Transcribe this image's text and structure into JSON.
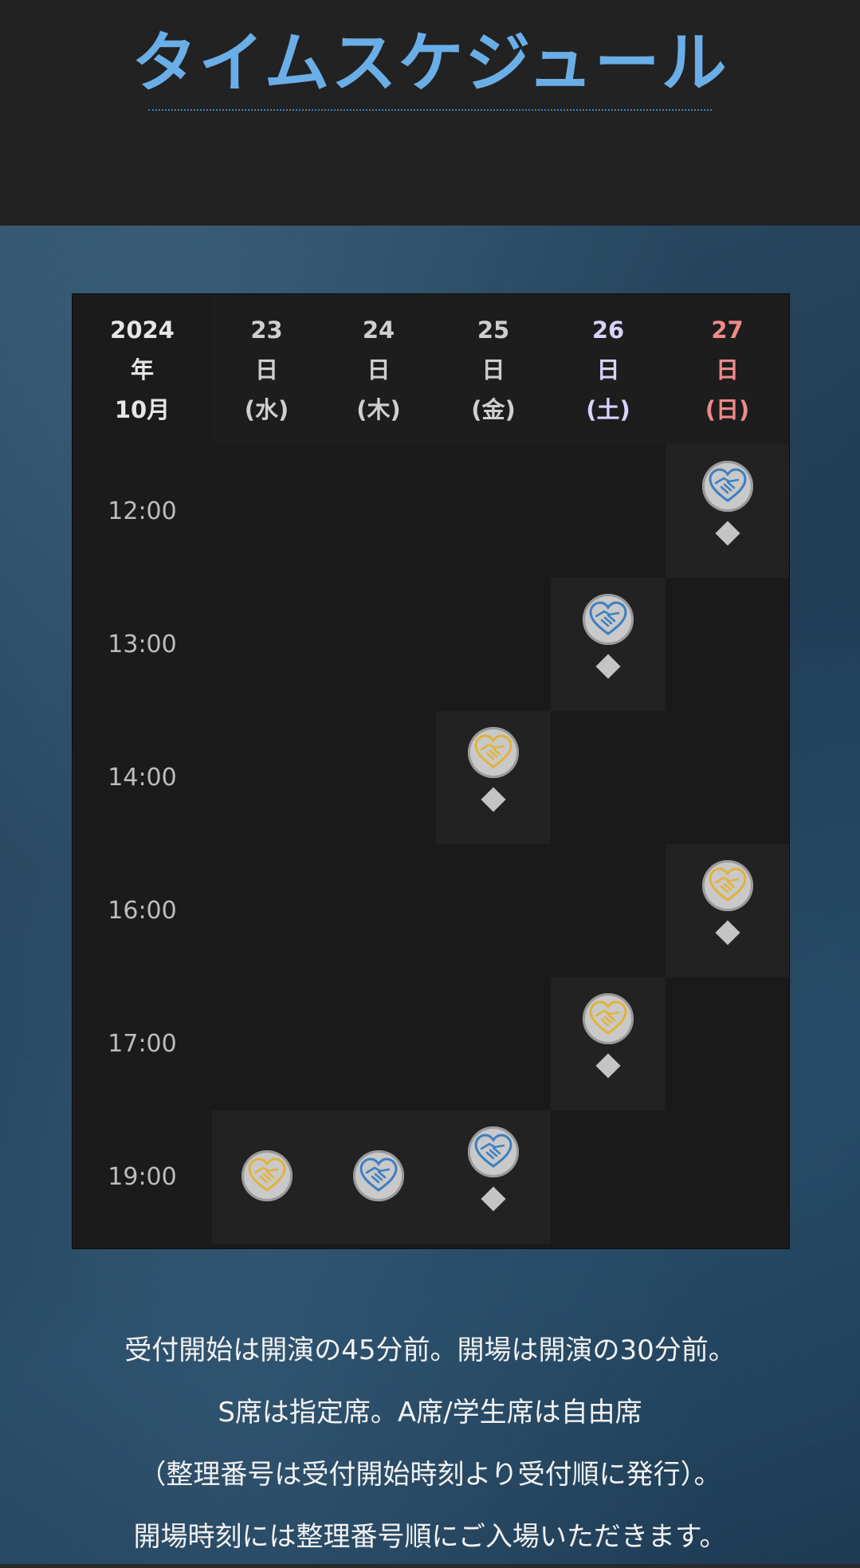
{
  "page": {
    "title": "タイムスケジュール",
    "title_color": "#6aaee8"
  },
  "table": {
    "corner": [
      "2024",
      "年",
      "10月"
    ],
    "days": [
      {
        "lines": [
          "23",
          "日",
          "(水)"
        ],
        "color": "#cfcfcf"
      },
      {
        "lines": [
          "24",
          "日",
          "(木)"
        ],
        "color": "#cfcfcf"
      },
      {
        "lines": [
          "25",
          "日",
          "(金)"
        ],
        "color": "#cfcfcf"
      },
      {
        "lines": [
          "26",
          "日",
          "(土)"
        ],
        "color": "#d9d2ff"
      },
      {
        "lines": [
          "27",
          "日",
          "(日)"
        ],
        "color": "#f08a8a"
      }
    ],
    "times": [
      "12:00",
      "13:00",
      "14:00",
      "16:00",
      "17:00",
      "19:00"
    ],
    "slots": [
      {
        "time": "12:00",
        "day": "27",
        "icon": "handshake-heart-icon",
        "icon_color": "blue",
        "diamond": true
      },
      {
        "time": "13:00",
        "day": "26",
        "icon": "handshake-heart-icon",
        "icon_color": "blue",
        "diamond": true
      },
      {
        "time": "14:00",
        "day": "25",
        "icon": "handshake-heart-icon",
        "icon_color": "gold",
        "diamond": true
      },
      {
        "time": "16:00",
        "day": "27",
        "icon": "handshake-heart-icon",
        "icon_color": "gold",
        "diamond": true
      },
      {
        "time": "17:00",
        "day": "26",
        "icon": "handshake-heart-icon",
        "icon_color": "gold",
        "diamond": true
      },
      {
        "time": "19:00",
        "day": "23",
        "icon": "handshake-heart-icon",
        "icon_color": "gold",
        "diamond": false
      },
      {
        "time": "19:00",
        "day": "24",
        "icon": "handshake-heart-icon",
        "icon_color": "blue",
        "diamond": false
      },
      {
        "time": "19:00",
        "day": "25",
        "icon": "handshake-heart-icon",
        "icon_color": "blue",
        "diamond": true
      }
    ],
    "icon_colors": {
      "blue": "#3d7fc1",
      "gold": "#e2b23a"
    }
  },
  "notes": [
    "受付開始は開演の45分前。開場は開演の30分前。",
    "S席は指定席。A席/学生席は自由席",
    "（整理番号は受付開始時刻より受付順に発行）。",
    "開場時刻には整理番号順にご入場いただきます。"
  ]
}
